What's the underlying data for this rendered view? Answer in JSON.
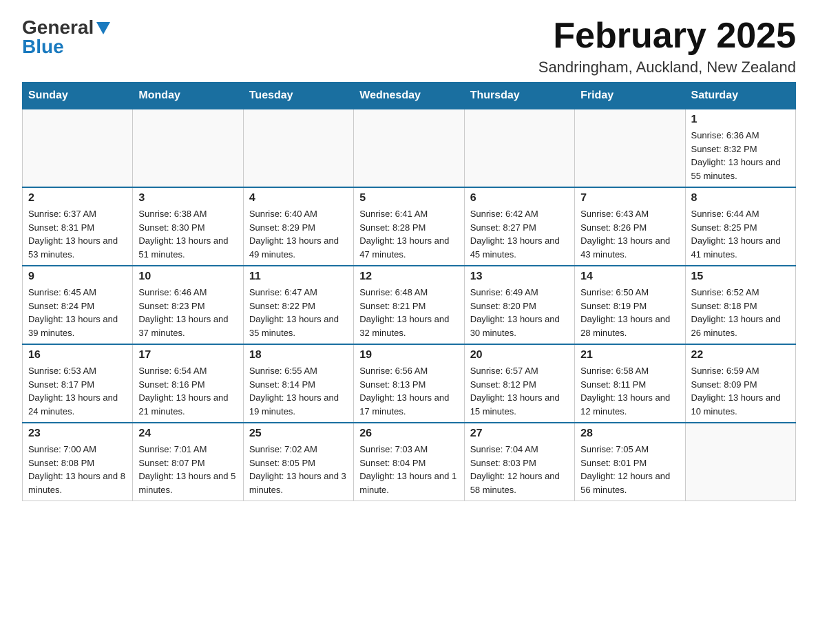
{
  "logo": {
    "general": "General",
    "blue": "Blue"
  },
  "title": "February 2025",
  "subtitle": "Sandringham, Auckland, New Zealand",
  "days_of_week": [
    "Sunday",
    "Monday",
    "Tuesday",
    "Wednesday",
    "Thursday",
    "Friday",
    "Saturday"
  ],
  "weeks": [
    [
      {
        "day": "",
        "info": ""
      },
      {
        "day": "",
        "info": ""
      },
      {
        "day": "",
        "info": ""
      },
      {
        "day": "",
        "info": ""
      },
      {
        "day": "",
        "info": ""
      },
      {
        "day": "",
        "info": ""
      },
      {
        "day": "1",
        "info": "Sunrise: 6:36 AM\nSunset: 8:32 PM\nDaylight: 13 hours and 55 minutes."
      }
    ],
    [
      {
        "day": "2",
        "info": "Sunrise: 6:37 AM\nSunset: 8:31 PM\nDaylight: 13 hours and 53 minutes."
      },
      {
        "day": "3",
        "info": "Sunrise: 6:38 AM\nSunset: 8:30 PM\nDaylight: 13 hours and 51 minutes."
      },
      {
        "day": "4",
        "info": "Sunrise: 6:40 AM\nSunset: 8:29 PM\nDaylight: 13 hours and 49 minutes."
      },
      {
        "day": "5",
        "info": "Sunrise: 6:41 AM\nSunset: 8:28 PM\nDaylight: 13 hours and 47 minutes."
      },
      {
        "day": "6",
        "info": "Sunrise: 6:42 AM\nSunset: 8:27 PM\nDaylight: 13 hours and 45 minutes."
      },
      {
        "day": "7",
        "info": "Sunrise: 6:43 AM\nSunset: 8:26 PM\nDaylight: 13 hours and 43 minutes."
      },
      {
        "day": "8",
        "info": "Sunrise: 6:44 AM\nSunset: 8:25 PM\nDaylight: 13 hours and 41 minutes."
      }
    ],
    [
      {
        "day": "9",
        "info": "Sunrise: 6:45 AM\nSunset: 8:24 PM\nDaylight: 13 hours and 39 minutes."
      },
      {
        "day": "10",
        "info": "Sunrise: 6:46 AM\nSunset: 8:23 PM\nDaylight: 13 hours and 37 minutes."
      },
      {
        "day": "11",
        "info": "Sunrise: 6:47 AM\nSunset: 8:22 PM\nDaylight: 13 hours and 35 minutes."
      },
      {
        "day": "12",
        "info": "Sunrise: 6:48 AM\nSunset: 8:21 PM\nDaylight: 13 hours and 32 minutes."
      },
      {
        "day": "13",
        "info": "Sunrise: 6:49 AM\nSunset: 8:20 PM\nDaylight: 13 hours and 30 minutes."
      },
      {
        "day": "14",
        "info": "Sunrise: 6:50 AM\nSunset: 8:19 PM\nDaylight: 13 hours and 28 minutes."
      },
      {
        "day": "15",
        "info": "Sunrise: 6:52 AM\nSunset: 8:18 PM\nDaylight: 13 hours and 26 minutes."
      }
    ],
    [
      {
        "day": "16",
        "info": "Sunrise: 6:53 AM\nSunset: 8:17 PM\nDaylight: 13 hours and 24 minutes."
      },
      {
        "day": "17",
        "info": "Sunrise: 6:54 AM\nSunset: 8:16 PM\nDaylight: 13 hours and 21 minutes."
      },
      {
        "day": "18",
        "info": "Sunrise: 6:55 AM\nSunset: 8:14 PM\nDaylight: 13 hours and 19 minutes."
      },
      {
        "day": "19",
        "info": "Sunrise: 6:56 AM\nSunset: 8:13 PM\nDaylight: 13 hours and 17 minutes."
      },
      {
        "day": "20",
        "info": "Sunrise: 6:57 AM\nSunset: 8:12 PM\nDaylight: 13 hours and 15 minutes."
      },
      {
        "day": "21",
        "info": "Sunrise: 6:58 AM\nSunset: 8:11 PM\nDaylight: 13 hours and 12 minutes."
      },
      {
        "day": "22",
        "info": "Sunrise: 6:59 AM\nSunset: 8:09 PM\nDaylight: 13 hours and 10 minutes."
      }
    ],
    [
      {
        "day": "23",
        "info": "Sunrise: 7:00 AM\nSunset: 8:08 PM\nDaylight: 13 hours and 8 minutes."
      },
      {
        "day": "24",
        "info": "Sunrise: 7:01 AM\nSunset: 8:07 PM\nDaylight: 13 hours and 5 minutes."
      },
      {
        "day": "25",
        "info": "Sunrise: 7:02 AM\nSunset: 8:05 PM\nDaylight: 13 hours and 3 minutes."
      },
      {
        "day": "26",
        "info": "Sunrise: 7:03 AM\nSunset: 8:04 PM\nDaylight: 13 hours and 1 minute."
      },
      {
        "day": "27",
        "info": "Sunrise: 7:04 AM\nSunset: 8:03 PM\nDaylight: 12 hours and 58 minutes."
      },
      {
        "day": "28",
        "info": "Sunrise: 7:05 AM\nSunset: 8:01 PM\nDaylight: 12 hours and 56 minutes."
      },
      {
        "day": "",
        "info": ""
      }
    ]
  ]
}
